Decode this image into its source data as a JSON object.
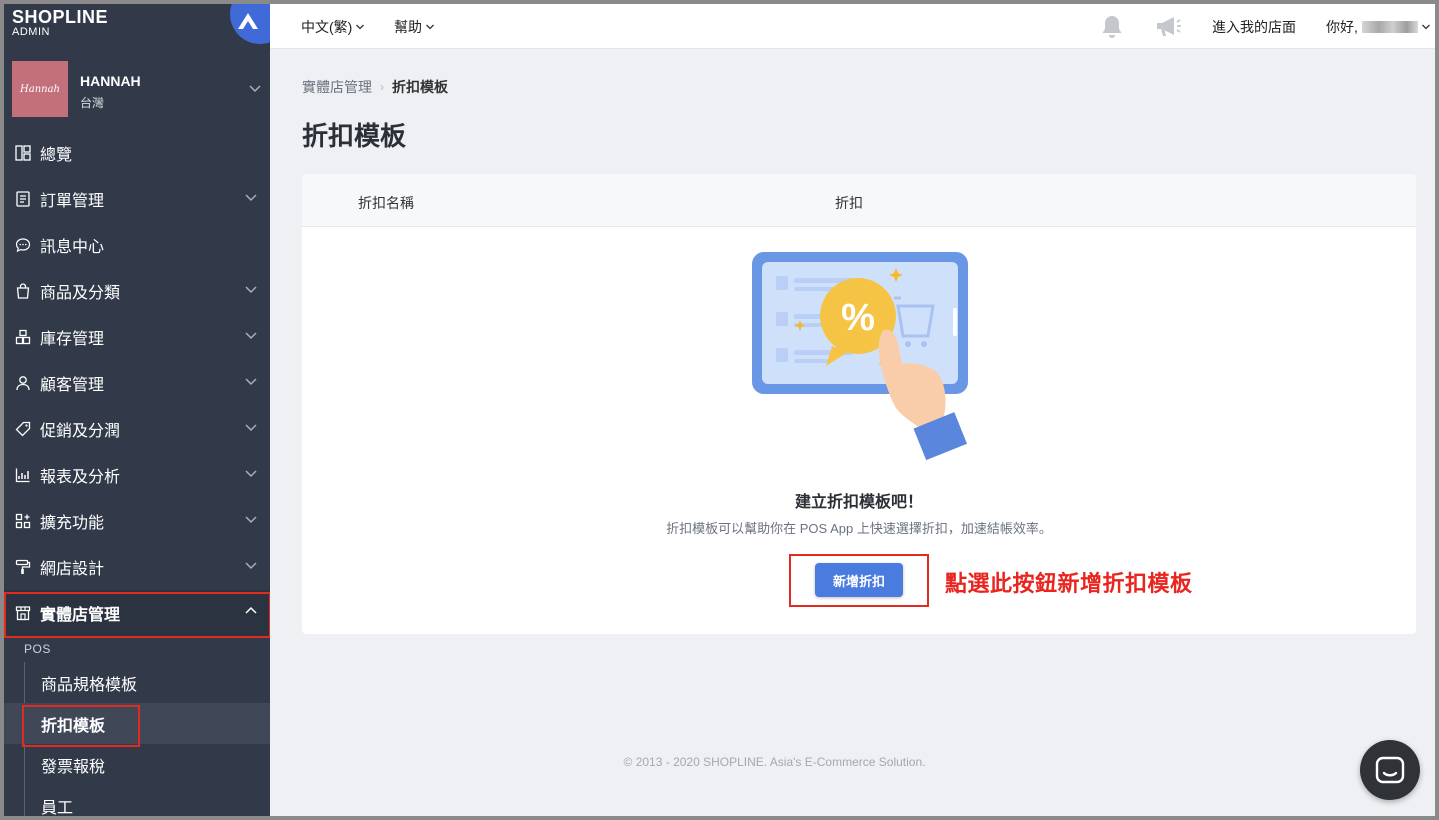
{
  "brand": {
    "logo": "SHOPLINE",
    "sub": "ADMIN"
  },
  "store": {
    "avatar_text": "Hannah",
    "name": "HANNAH",
    "region": "台灣"
  },
  "nav": [
    {
      "label": "總覽",
      "icon": "dashboard-icon"
    },
    {
      "label": "訂單管理",
      "icon": "order-icon"
    },
    {
      "label": "訊息中心",
      "icon": "message-icon"
    },
    {
      "label": "商品及分類",
      "icon": "bag-icon"
    },
    {
      "label": "庫存管理",
      "icon": "inventory-icon"
    },
    {
      "label": "顧客管理",
      "icon": "user-icon"
    },
    {
      "label": "促銷及分潤",
      "icon": "tag-icon"
    },
    {
      "label": "報表及分析",
      "icon": "chart-icon"
    },
    {
      "label": "擴充功能",
      "icon": "apps-icon"
    },
    {
      "label": "網店設計",
      "icon": "paint-roller-icon"
    },
    {
      "label": "實體店管理",
      "icon": "store-icon"
    }
  ],
  "section_label": "POS",
  "subnav": [
    "商品規格模板",
    "折扣模板",
    "發票報稅",
    "員工"
  ],
  "topbar": {
    "language": "中文(繁)",
    "help": "幫助",
    "enter_store": "進入我的店面",
    "greeting": "你好,"
  },
  "breadcrumb": {
    "parent": "實體店管理",
    "current": "折扣模板"
  },
  "page_title": "折扣模板",
  "table": {
    "col_name": "折扣名稱",
    "col_discount": "折扣"
  },
  "empty_state": {
    "title": "建立折扣模板吧！",
    "description": "折扣模板可以幫助你在 POS App 上快速選擇折扣，加速結帳效率。",
    "button": "新增折扣",
    "illustration_symbol": "%"
  },
  "annotation": "點選此按鈕新增折扣模板",
  "footer": "© 2013 - 2020 SHOPLINE. Asia's E-Commerce Solution.",
  "colors": {
    "sidebar": "#323a49",
    "primary": "#4a7ce0",
    "highlight": "#e02b20"
  }
}
